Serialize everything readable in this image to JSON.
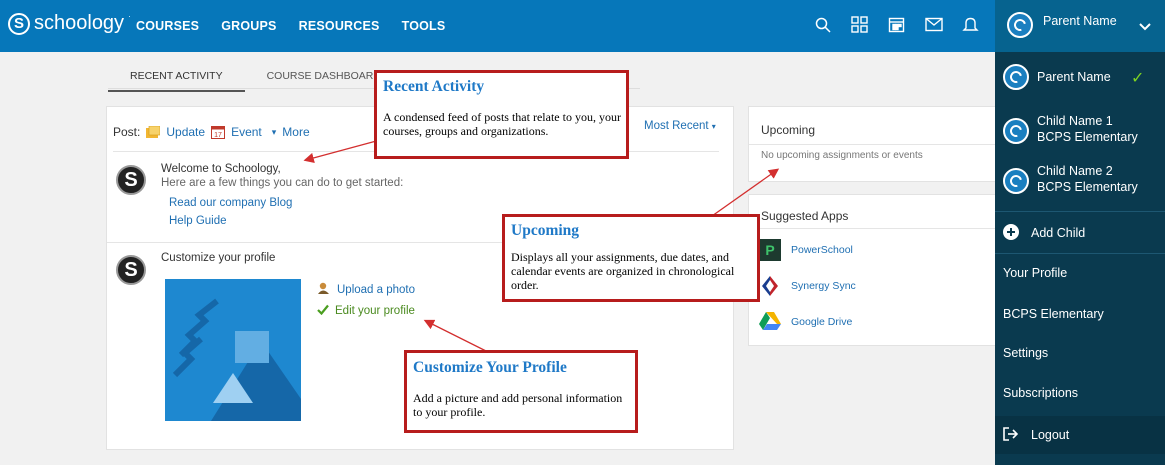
{
  "brand": {
    "name": "schoology",
    "mark": "S"
  },
  "nav": {
    "links": [
      "COURSES",
      "GROUPS",
      "RESOURCES",
      "TOOLS"
    ]
  },
  "nav_icons": [
    "search-icon",
    "grid-icon",
    "calendar-icon",
    "mail-icon",
    "bell-icon"
  ],
  "account": {
    "name": "Parent Name",
    "menu": {
      "current": "Parent Name",
      "children": [
        {
          "name": "Child Name 1",
          "school": "BCPS Elementary"
        },
        {
          "name": "Child Name 2",
          "school": "BCPS Elementary"
        }
      ],
      "add_child": "Add Child",
      "your_profile": "Your Profile",
      "school": "BCPS Elementary",
      "settings": "Settings",
      "subscriptions": "Subscriptions",
      "logout": "Logout"
    }
  },
  "tabs": [
    "RECENT ACTIVITY",
    "COURSE DASHBOARD"
  ],
  "feed": {
    "post_label": "Post:",
    "update": "Update",
    "event": "Event",
    "more": "More",
    "sort": "Most Recent",
    "welcome": {
      "title": "Welcome to Schoology,",
      "subtitle": "Here are a few things you can do to get started:",
      "link1": "Read our company Blog",
      "link2": "Help Guide"
    },
    "customize": {
      "title": "Customize your profile",
      "upload": "Upload a photo",
      "edit": "Edit your profile"
    }
  },
  "upcoming": {
    "title": "Upcoming",
    "empty": "No upcoming assignments or events"
  },
  "suggested_apps": {
    "title": "Suggested Apps",
    "apps": [
      "PowerSchool",
      "Synergy Sync",
      "Google Drive"
    ]
  },
  "callouts": {
    "recent": {
      "title": "Recent Activity",
      "body": "A condensed feed of posts that relate to you, your courses, groups and organizations."
    },
    "upcoming": {
      "title": "Upcoming",
      "body": "Displays all your assignments, due dates, and calendar events are organized in chronological order."
    },
    "profile": {
      "title": "Customize Your Profile",
      "body": "Add a picture and add personal information to your profile."
    }
  },
  "colors": {
    "nav": "#0677ba",
    "menu": "#0a3a4f",
    "callout_border": "#b71c1c",
    "callout_title": "#1f79c7",
    "link": "#1f6fb2"
  }
}
